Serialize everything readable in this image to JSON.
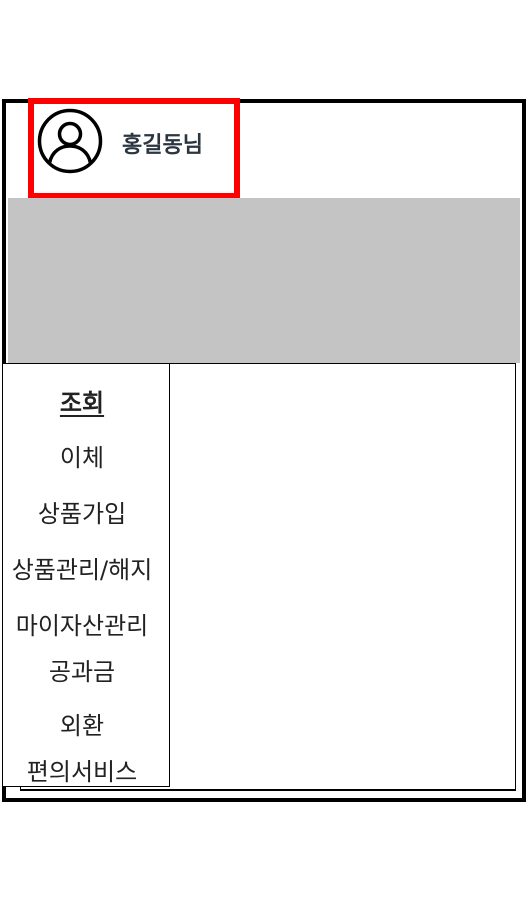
{
  "header": {
    "user_name": "홍길동님",
    "avatar_icon": "user-circle-icon",
    "highlight_color": "#ff0000"
  },
  "banner": {
    "color": "#c4c4c4"
  },
  "sidebar": {
    "active_item": "조회",
    "items": [
      {
        "label": "조회"
      },
      {
        "label": "이체"
      },
      {
        "label": "상품가입"
      },
      {
        "label": "상품관리/해지"
      },
      {
        "label": "마이자산관리"
      },
      {
        "label": "공과금"
      },
      {
        "label": "외환"
      },
      {
        "label": "편의서비스"
      }
    ]
  }
}
